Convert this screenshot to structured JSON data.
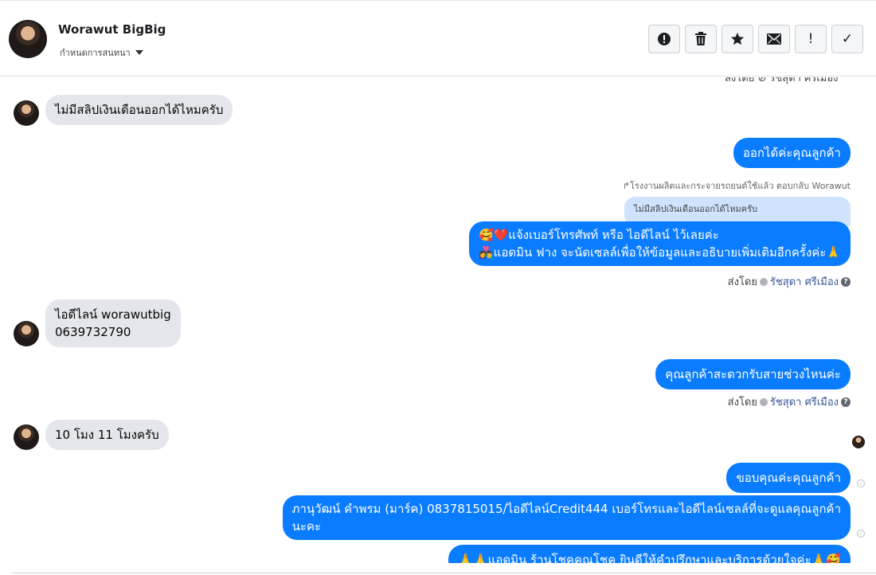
{
  "header": {
    "name": "Worawut BigBig",
    "assign_label": "กำหนดการสนทนา",
    "toolbar": {
      "icons": [
        "alert-circle-icon",
        "trash-icon",
        "star-icon",
        "envelope-icon",
        "exclamation-icon",
        "check-icon"
      ],
      "exclamation_glyph": "!",
      "check_glyph": "✓"
    }
  },
  "thread": {
    "top_sent_by": "ส่งโดย ⊘ รัชสุดา ศรีเมือง",
    "messages": [
      {
        "id": "m1",
        "dir": "in",
        "text": "ไม่มีสลิปเงินเดือนออกได้ไหมครับ"
      },
      {
        "id": "m2",
        "dir": "out",
        "text": "ออกได้ค่ะคุณลูกค้า"
      },
      {
        "id": "m3",
        "dir": "out",
        "reply_note": "↱โรงงานผลิตและกระจายรถยนต์ใช้แล้ว ตอบกลับ Worawut",
        "quoted": "ไม่มีสลิปเงินเดือนออกได้ไหมครับ",
        "line1": "🥰❤️แจ้งเบอร์โทรศัพท์ หรือ ไอดีไลน์  ไว้เลยค่ะ",
        "line2": "👩‍❤️‍👨แอดมิน ฟาง จะนัดเซลล์เพื่อให้ข้อมูลและอธิบายเพิ่มเติมอีกครั้งค่ะ🙏",
        "sent_by_prefix": "ส่งโดย",
        "sent_by_name": "รัชสุดา ศรีเมือง"
      },
      {
        "id": "m4",
        "dir": "in",
        "line1": "ไอดีไลน์  worawutbig",
        "line2": "0639732790"
      },
      {
        "id": "m5",
        "dir": "out",
        "text": "คุณลูกค้าสะดวกรับสายช่วงไหนค่ะ",
        "sent_by_prefix": "ส่งโดย",
        "sent_by_name": "รัชสุดา ศรีเมือง"
      },
      {
        "id": "m6",
        "dir": "in",
        "text": "10 โมง 11 โมงครับ"
      },
      {
        "id": "m7",
        "dir": "out",
        "text": "ขอบคุณค่ะคุณลูกค้า"
      },
      {
        "id": "m8",
        "dir": "out",
        "line1": "ภานุวัฒน์ คำพรม (มาร์ค)       0837815015/ไอดีไลน์Credit444  เบอร์โทรและไอดีไลน์เซลล์ที่จะดูแลคุณลูกค้า",
        "line2": "นะคะ"
      },
      {
        "id": "m9",
        "dir": "out",
        "text": "🙏🙏แอดมิน ร้านโชคคูณโชค ยินดีให้คำปรึกษาและบริการด้วยใจค่ะ🙏🥰"
      }
    ]
  },
  "colors": {
    "outgoing_bubble": "#0a7cff",
    "incoming_bubble": "#e4e6eb",
    "quoted_bubble": "#cfe3ff",
    "sent_by_link": "#385898"
  }
}
